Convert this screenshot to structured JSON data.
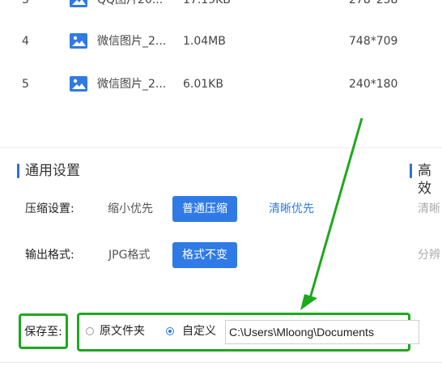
{
  "files": [
    {
      "index": "3",
      "name": "QQ图片20...",
      "size": "17.19KB",
      "resolution": "278*258"
    },
    {
      "index": "4",
      "name": "微信图片_2...",
      "size": "1.04MB",
      "resolution": "748*709"
    },
    {
      "index": "5",
      "name": "微信图片_2...",
      "size": "6.01KB",
      "resolution": "240*180"
    }
  ],
  "general_settings": {
    "title": "通用设置",
    "compression": {
      "label": "压缩设置:",
      "options": [
        "缩小优先",
        "普通压缩",
        "清晰优先"
      ],
      "selected": "普通压缩"
    },
    "format": {
      "label": "输出格式:",
      "options": [
        "JPG格式",
        "格式不变"
      ],
      "selected": "格式不变"
    }
  },
  "advanced_settings": {
    "title": "高效",
    "row1": "清晰",
    "row2": "分辨"
  },
  "save": {
    "label": "保存至:",
    "option_original": "原文件夹",
    "option_custom": "自定义",
    "selected": "自定义",
    "path": "C:\\Users\\Mloong\\Documents"
  },
  "colors": {
    "accent": "#2f7ae5",
    "highlight": "#1ea81e"
  }
}
